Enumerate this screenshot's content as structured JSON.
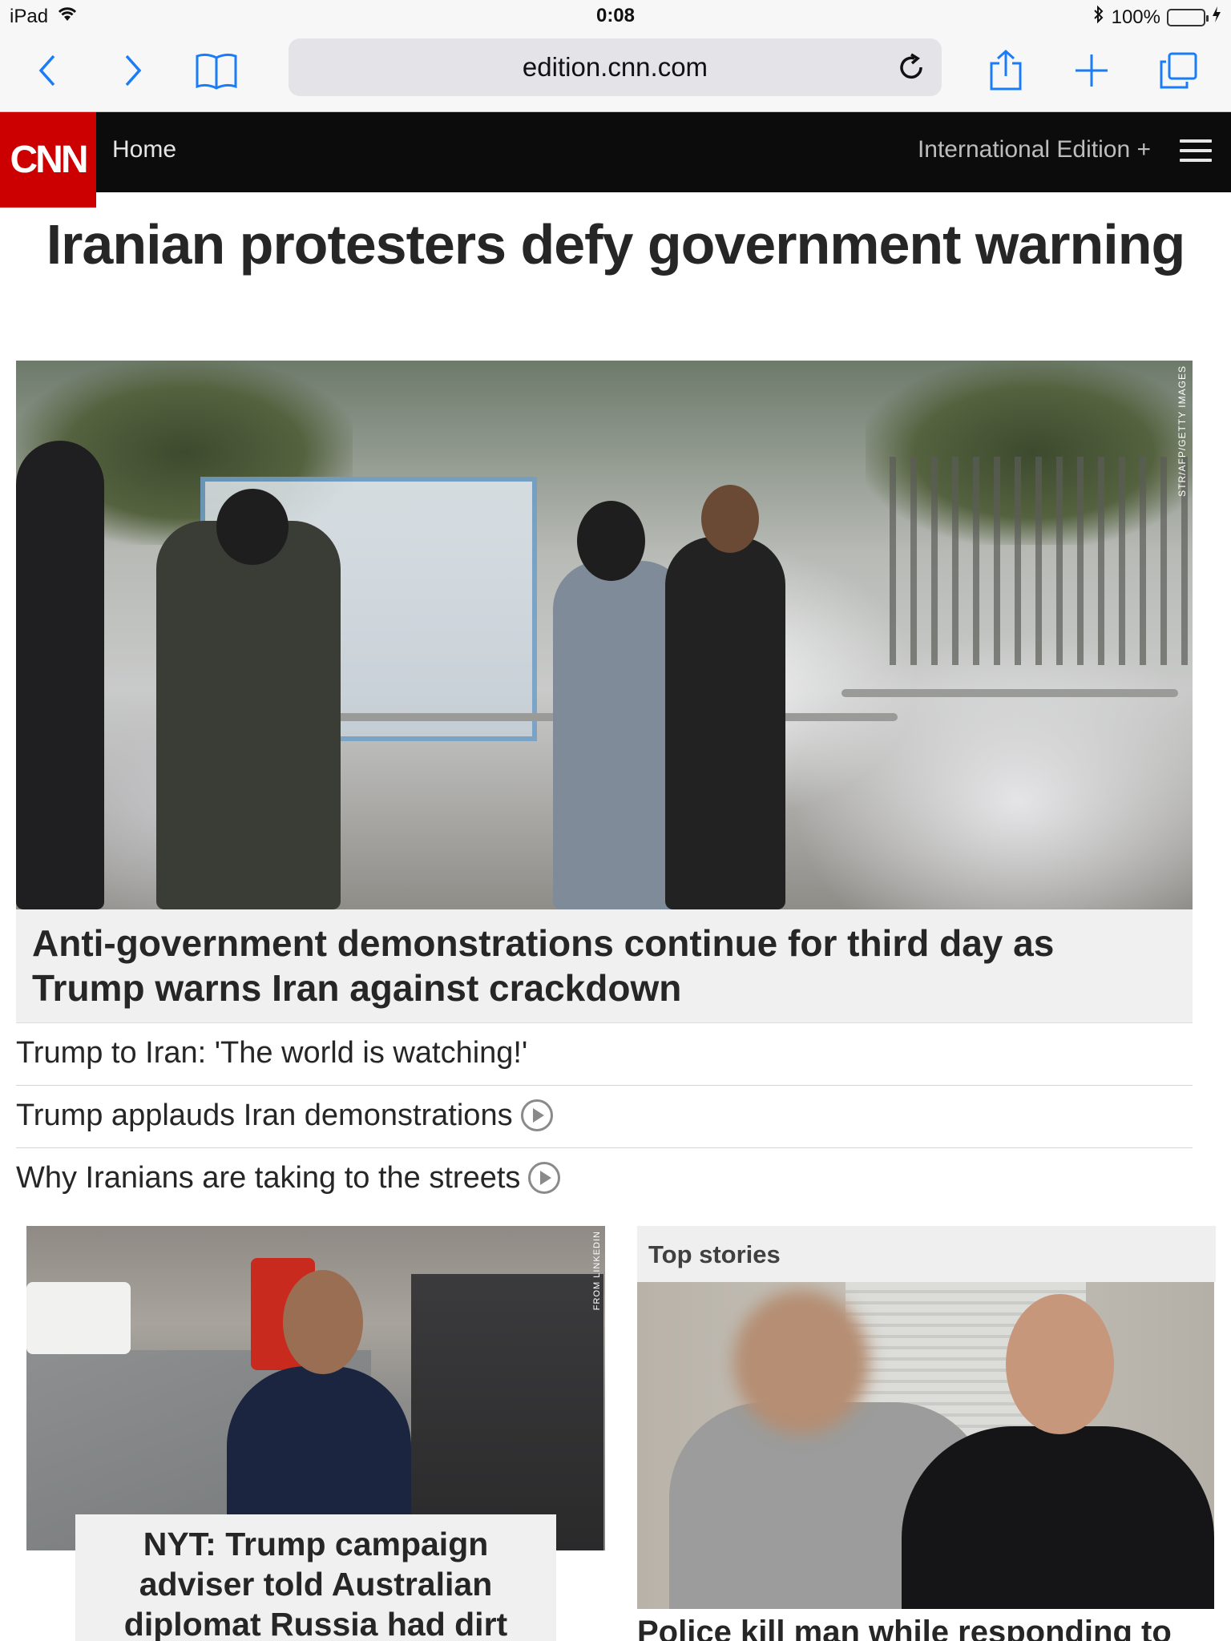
{
  "status_bar": {
    "device": "iPad",
    "time": "0:08",
    "battery": "100%",
    "battery_level": 1.0
  },
  "browser": {
    "url": "edition.cnn.com",
    "icons": [
      "back-icon",
      "forward-icon",
      "bookmarks-icon",
      "reload-icon",
      "share-icon",
      "new-tab-icon",
      "tabs-icon"
    ]
  },
  "header": {
    "logo": "CNN",
    "home": "Home",
    "edition": "International Edition +",
    "brand_color": "#cc0000"
  },
  "main": {
    "headline": "Iranian protesters defy government warning",
    "hero_credit": "STR/AFP/GETTY IMAGES",
    "hero_caption": "Anti-government demonstrations continue for third day as Trump warns Iran against crackdown",
    "related": [
      {
        "text": "Trump to Iran: 'The world is watching!'",
        "video": false
      },
      {
        "text": "Trump applauds Iran demonstrations",
        "video": true
      },
      {
        "text": "Why Iranians are taking to the streets",
        "video": true
      }
    ]
  },
  "left_story": {
    "credit": "FROM LINKEDIN",
    "caption": "NYT: Trump campaign adviser told Australian diplomat Russia had dirt"
  },
  "top_stories": {
    "label": "Top stories",
    "caption": "Police kill man while responding to"
  }
}
